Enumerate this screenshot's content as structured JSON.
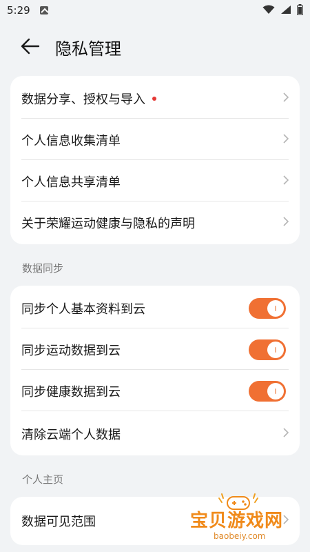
{
  "status_bar": {
    "time": "5:29"
  },
  "header": {
    "title": "隐私管理"
  },
  "card1": {
    "items": [
      {
        "label": "数据分享、授权与导入",
        "has_dot": true
      },
      {
        "label": "个人信息收集清单"
      },
      {
        "label": "个人信息共享清单"
      },
      {
        "label": "关于荣耀运动健康与隐私的声明"
      }
    ]
  },
  "section_sync": {
    "title": "数据同步",
    "items": [
      {
        "label": "同步个人基本资料到云",
        "toggle": true
      },
      {
        "label": "同步运动数据到云",
        "toggle": true
      },
      {
        "label": "同步健康数据到云",
        "toggle": true
      },
      {
        "label": "清除云端个人数据"
      }
    ]
  },
  "section_home": {
    "title": "个人主页",
    "items": [
      {
        "label": "数据可见范围"
      }
    ]
  },
  "colors": {
    "accent": "#f07033",
    "dot": "#e53935",
    "background": "#f1f3f5"
  },
  "watermark": {
    "title": "宝贝游戏网",
    "url": "baobeiy.com"
  }
}
